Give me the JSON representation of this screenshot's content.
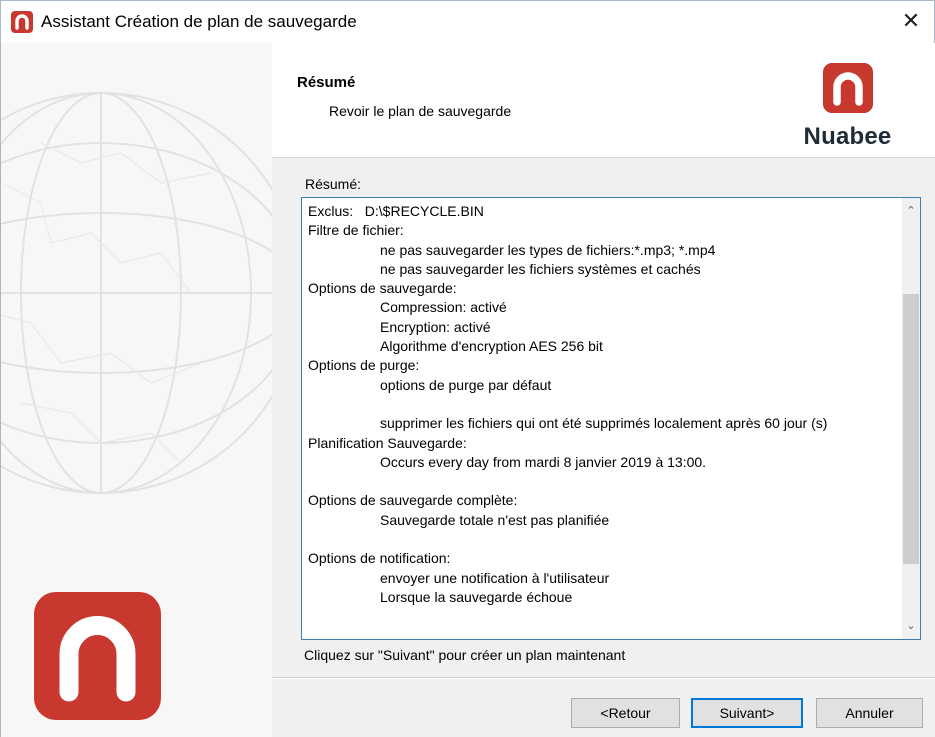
{
  "window": {
    "title": "Assistant Création de plan de sauvegarde",
    "close_glyph": "✕"
  },
  "header": {
    "title": "Résumé",
    "subtitle": "Revoir le plan de sauvegarde",
    "brand_name": "Nuabee"
  },
  "summary": {
    "label": "Résumé:",
    "lines": [
      {
        "text": "Exclus:   D:\\$RECYCLE.BIN",
        "indent": false
      },
      {
        "text": "Filtre de fichier:",
        "indent": false
      },
      {
        "text": "ne pas sauvegarder les types de fichiers:*.mp3; *.mp4",
        "indent": true
      },
      {
        "text": "ne pas sauvegarder les fichiers systèmes et cachés",
        "indent": true
      },
      {
        "text": "Options de sauvegarde:",
        "indent": false
      },
      {
        "text": "Compression: activé",
        "indent": true
      },
      {
        "text": "Encryption: activé",
        "indent": true
      },
      {
        "text": "Algorithme d'encryption AES 256 bit",
        "indent": true
      },
      {
        "text": "Options de purge:",
        "indent": false
      },
      {
        "text": "options de purge par défaut",
        "indent": true
      },
      {
        "text": "",
        "indent": false
      },
      {
        "text": "supprimer les fichiers qui ont été supprimés localement après 60 jour (s)",
        "indent": true
      },
      {
        "text": "Planification Sauvegarde:",
        "indent": false
      },
      {
        "text": "Occurs every day from mardi 8 janvier 2019 à 13:00.",
        "indent": true
      },
      {
        "text": "",
        "indent": false
      },
      {
        "text": "Options de sauvegarde complète:",
        "indent": false
      },
      {
        "text": "Sauvegarde totale n'est pas planifiée",
        "indent": true
      },
      {
        "text": "",
        "indent": false
      },
      {
        "text": "Options de notification:",
        "indent": false
      },
      {
        "text": "envoyer une notification à l'utilisateur",
        "indent": true
      },
      {
        "text": "Lorsque la sauvegarde échoue",
        "indent": true
      }
    ],
    "scroll_up_glyph": "⌃",
    "scroll_down_glyph": "⌄"
  },
  "hint": "Cliquez sur \"Suivant\" pour créer un plan maintenant",
  "buttons": {
    "back": "<Retour",
    "next": "Suivant>",
    "cancel": "Annuler"
  },
  "colors": {
    "brand_red": "#c8382e",
    "brand_dark": "#1f2c38",
    "focus_blue": "#0078d7"
  },
  "icons": {
    "app": "nuabee-logo-icon",
    "close": "close-icon",
    "scroll_up": "chevron-up-icon",
    "scroll_down": "chevron-down-icon"
  }
}
